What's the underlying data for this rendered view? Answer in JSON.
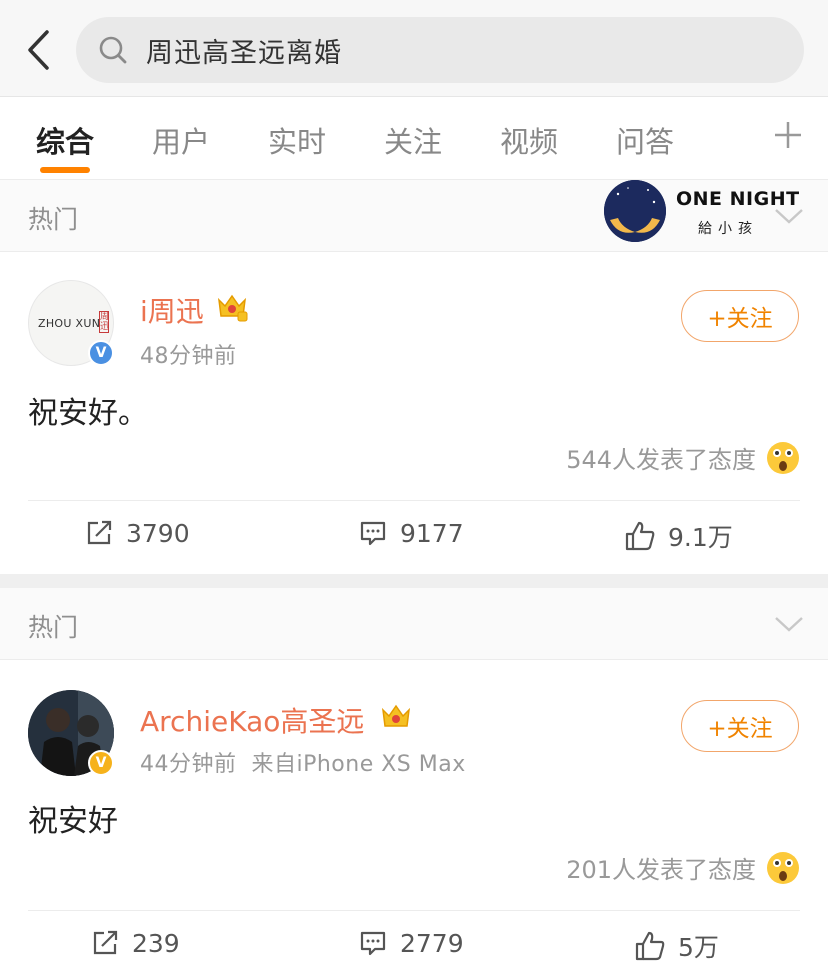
{
  "search": {
    "query": "周迅高圣远离婚"
  },
  "tabs": [
    {
      "label": "综合"
    },
    {
      "label": "用户"
    },
    {
      "label": "实时"
    },
    {
      "label": "关注"
    },
    {
      "label": "视频"
    },
    {
      "label": "问答"
    }
  ],
  "section_label": "热门",
  "ad": {
    "title": "ONE NIGHT",
    "subtitle": "給小孩"
  },
  "posts": [
    {
      "avatar_text": "ZHOU XUN",
      "avatar_seal": "周迅",
      "username": "i周迅",
      "meta": "48分钟前",
      "follow_label": "+关注",
      "text": "祝安好。",
      "attitude": "544人发表了态度",
      "repost": "3790",
      "comment": "9177",
      "like": "9.1万",
      "verify_color": "#4a90e2"
    },
    {
      "username": "ArchieKao高圣远",
      "meta": "44分钟前  来自iPhone XS Max",
      "follow_label": "+关注",
      "text": "祝安好",
      "attitude": "201人发表了态度",
      "repost": "239",
      "comment": "2779",
      "like": "5万",
      "verify_color": "#f6b21b"
    }
  ],
  "colors": {
    "accent": "#ff8200",
    "username": "#eb7350",
    "follow": "#f08300"
  }
}
